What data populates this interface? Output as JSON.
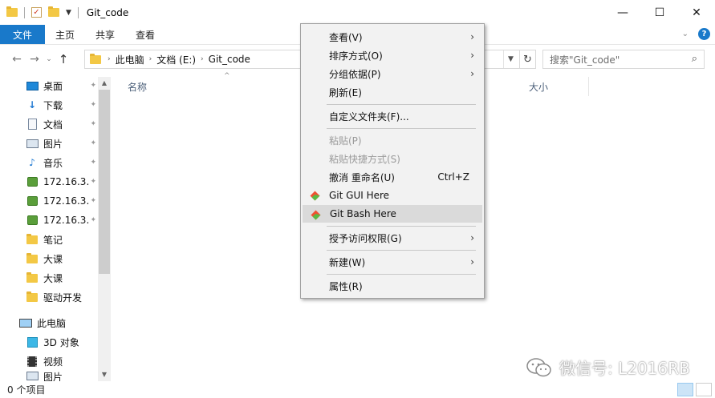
{
  "window": {
    "title": "Git_code",
    "controls": {
      "minimize": "—",
      "maximize": "☐",
      "close": "✕"
    }
  },
  "ribbon": {
    "tabs": [
      "文件",
      "主页",
      "共享",
      "查看"
    ],
    "expand": "⌄",
    "help": "?"
  },
  "nav": {
    "back": "←",
    "forward": "→",
    "recent": "⌄",
    "up": "↑",
    "breadcrumb": [
      "此电脑",
      "文档 (E:)",
      "Git_code"
    ],
    "refresh": "↻",
    "search_placeholder": "搜索\"Git_code\"",
    "search_icon": "⌕"
  },
  "sidebar": {
    "quick_access": [
      {
        "label": "桌面",
        "icon": "desktop-icon",
        "pinned": true
      },
      {
        "label": "下载",
        "icon": "download-icon",
        "pinned": true
      },
      {
        "label": "文档",
        "icon": "document-icon",
        "pinned": true
      },
      {
        "label": "图片",
        "icon": "picture-icon",
        "pinned": true
      },
      {
        "label": "音乐",
        "icon": "music-icon",
        "pinned": true
      },
      {
        "label": "172.16.3.",
        "icon": "network-drive-icon",
        "pinned": true
      },
      {
        "label": "172.16.3.",
        "icon": "network-drive-icon",
        "pinned": true
      },
      {
        "label": "172.16.3.",
        "icon": "network-drive-icon",
        "pinned": true
      },
      {
        "label": "笔记",
        "icon": "folder-icon",
        "pinned": false
      },
      {
        "label": "大课",
        "icon": "folder-icon",
        "pinned": false
      },
      {
        "label": "大课",
        "icon": "folder-icon",
        "pinned": false
      },
      {
        "label": "驱动开发",
        "icon": "folder-icon",
        "pinned": false
      }
    ],
    "this_pc": {
      "label": "此电脑",
      "icon": "computer-icon"
    },
    "this_pc_items": [
      {
        "label": "3D 对象",
        "icon": "3d-objects-icon"
      },
      {
        "label": "视频",
        "icon": "video-icon"
      },
      {
        "label": "图片",
        "icon": "picture-icon"
      }
    ],
    "pin_glyph": "📌"
  },
  "content": {
    "columns": {
      "name": "名称",
      "size": "大小"
    },
    "sort_indicator": "^"
  },
  "status": {
    "item_count": "0 个项目"
  },
  "watermark": {
    "text": "微信号: L2016RB"
  },
  "context_menu": {
    "items": [
      {
        "label": "查看(V)",
        "submenu": true,
        "disabled": false
      },
      {
        "label": "排序方式(O)",
        "submenu": true,
        "disabled": false
      },
      {
        "label": "分组依据(P)",
        "submenu": true,
        "disabled": false
      },
      {
        "label": "刷新(E)",
        "submenu": false,
        "disabled": false
      },
      {
        "label": "自定义文件夹(F)...",
        "submenu": false,
        "disabled": false
      },
      {
        "label": "粘贴(P)",
        "submenu": false,
        "disabled": true
      },
      {
        "label": "粘贴快捷方式(S)",
        "submenu": false,
        "disabled": true
      },
      {
        "label": "撤消 重命名(U)",
        "shortcut": "Ctrl+Z",
        "submenu": false,
        "disabled": false
      },
      {
        "label": "Git GUI Here",
        "icon": "git-icon",
        "submenu": false,
        "disabled": false
      },
      {
        "label": "Git Bash Here",
        "icon": "git-icon",
        "submenu": false,
        "disabled": false,
        "highlighted": true
      },
      {
        "label": "授予访问权限(G)",
        "submenu": true,
        "disabled": false
      },
      {
        "label": "新建(W)",
        "submenu": true,
        "disabled": false
      },
      {
        "label": "属性(R)",
        "submenu": false,
        "disabled": false
      }
    ],
    "arrow": "›"
  },
  "colors": {
    "accent": "#1979ca",
    "menu_bg": "#f2f2f2",
    "menu_highlight": "#dadada",
    "disabled_text": "#9b9b9b",
    "git_orange": "#f05133",
    "git_green": "#5bb944"
  }
}
